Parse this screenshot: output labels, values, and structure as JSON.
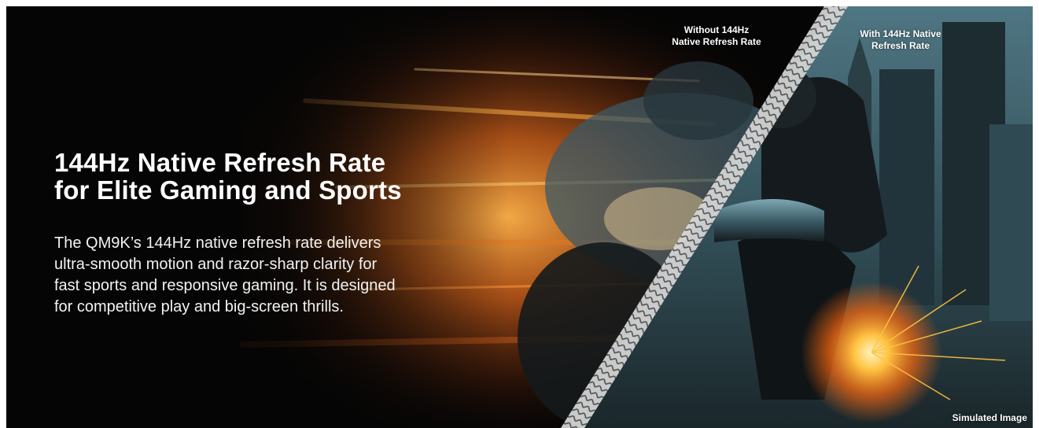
{
  "banner": {
    "headline_line1": "144Hz Native Refresh Rate",
    "headline_line2": "for Elite Gaming and Sports",
    "description_lines": [
      "The QM9K’s 144Hz native refresh rate delivers",
      "ultra-smooth motion and razor-sharp clarity for",
      "fast sports and responsive gaming. It is designed",
      "for competitive play and big-screen thrills."
    ],
    "comparison": {
      "left_label_line1": "Without 144Hz",
      "left_label_line2": "Native Refresh Rate",
      "right_label_line1": "With 144Hz Native",
      "right_label_line2": "Refresh Rate"
    },
    "disclaimer": "Simulated Image"
  },
  "colors": {
    "background": "#050505",
    "text": "#ffffff",
    "fire_orange": "#ff8a1e",
    "steel_blue": "#5f8ea0"
  }
}
